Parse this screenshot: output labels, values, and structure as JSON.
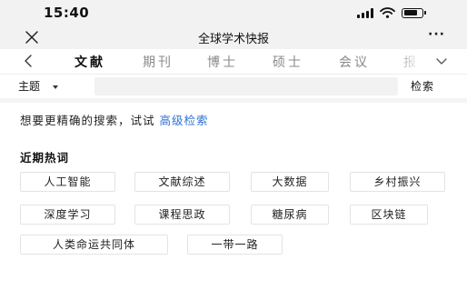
{
  "status_bar": {
    "time": "15:40",
    "signal_bars": 4,
    "battery_level": 0.8,
    "icons": [
      "signal-icon",
      "wifi-icon",
      "battery-icon"
    ]
  },
  "nav": {
    "title": "全球学术快报",
    "close_icon": "close-icon",
    "more_label": "···"
  },
  "tabs": {
    "back_icon": "chevron-left-icon",
    "items": [
      {
        "label": "文献",
        "active": true
      },
      {
        "label": "期刊",
        "active": false
      },
      {
        "label": "博士",
        "active": false
      },
      {
        "label": "硕士",
        "active": false
      },
      {
        "label": "会议",
        "active": false
      },
      {
        "label": "报",
        "active": false
      }
    ],
    "more_icon": "chevron-down-icon"
  },
  "search": {
    "subject_label": "主题",
    "input_value": "",
    "placeholder": "",
    "button_label": "检索"
  },
  "hint": {
    "text": "想要更精确的搜索，试试",
    "link_label": "高级检索"
  },
  "hot": {
    "title": "近期热词",
    "tags": [
      "人工智能",
      "文献综述",
      "大数据",
      "乡村振兴",
      "深度学习",
      "课程思政",
      "糖尿病",
      "区块链",
      "人类命运共同体",
      "一带一路"
    ]
  },
  "colors": {
    "accent": "#2f73d6",
    "bar_background": "#f2f2f2",
    "tag_border": "#e3e3e3"
  }
}
